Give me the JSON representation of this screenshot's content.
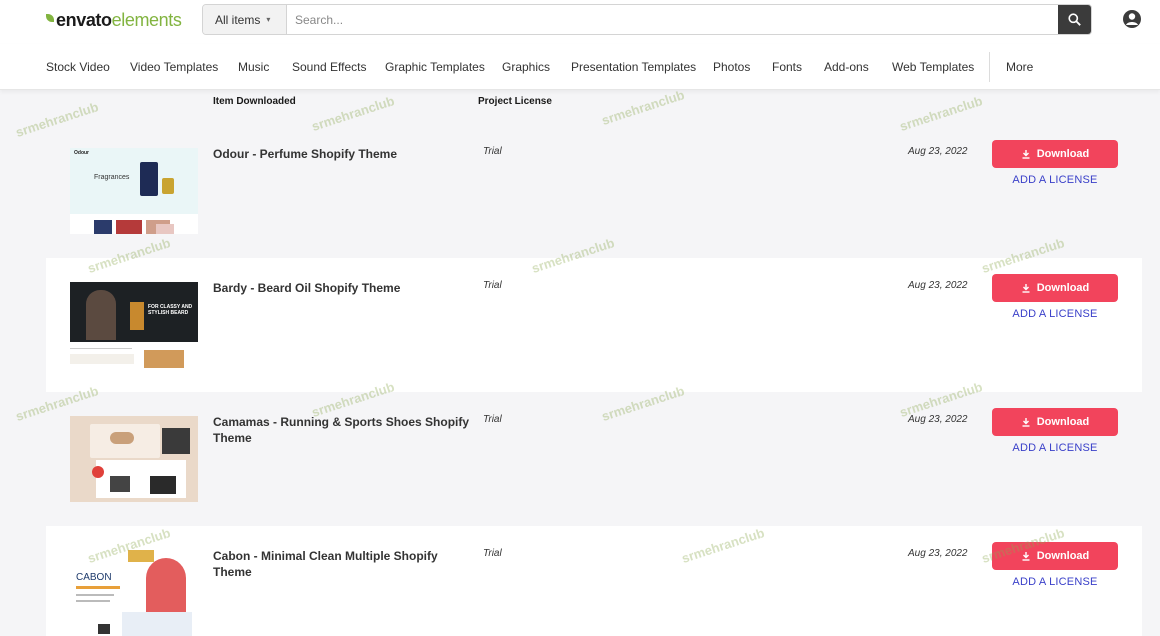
{
  "logo": {
    "part1": "envato",
    "part2": "elements"
  },
  "search": {
    "category": "All items",
    "placeholder": "Search..."
  },
  "nav": [
    "Stock Video",
    "Video Templates",
    "Music",
    "Sound Effects",
    "Graphic Templates",
    "Graphics",
    "Presentation Templates",
    "Photos",
    "Fonts",
    "Add-ons",
    "Web Templates",
    "More"
  ],
  "table": {
    "columns": {
      "item": "Item Downloaded",
      "license": "Project License"
    },
    "download_label": "Download",
    "add_license_label": "ADD A LICENSE",
    "rows": [
      {
        "title": "Odour - Perfume Shopify Theme",
        "license": "Trial",
        "date": "Aug 23, 2022"
      },
      {
        "title": "Bardy - Beard Oil Shopify Theme",
        "license": "Trial",
        "date": "Aug 23, 2022"
      },
      {
        "title": "Camamas - Running & Sports Shoes Shopify Theme",
        "license": "Trial",
        "date": "Aug 23, 2022"
      },
      {
        "title": "Cabon - Minimal Clean Multiple Shopify Theme",
        "license": "Trial",
        "date": "Aug 23, 2022"
      }
    ]
  },
  "thumb_text": {
    "fragrances": "Fragrances",
    "odour": "Odour",
    "bardy_head": "FOR CLASSY AND STYLISH BEARD",
    "cabon": "CABON"
  },
  "watermark": "srmehranclub",
  "colors": {
    "brand_green": "#82b440",
    "download_red": "#f2445c",
    "license_link": "#3a40c9"
  }
}
